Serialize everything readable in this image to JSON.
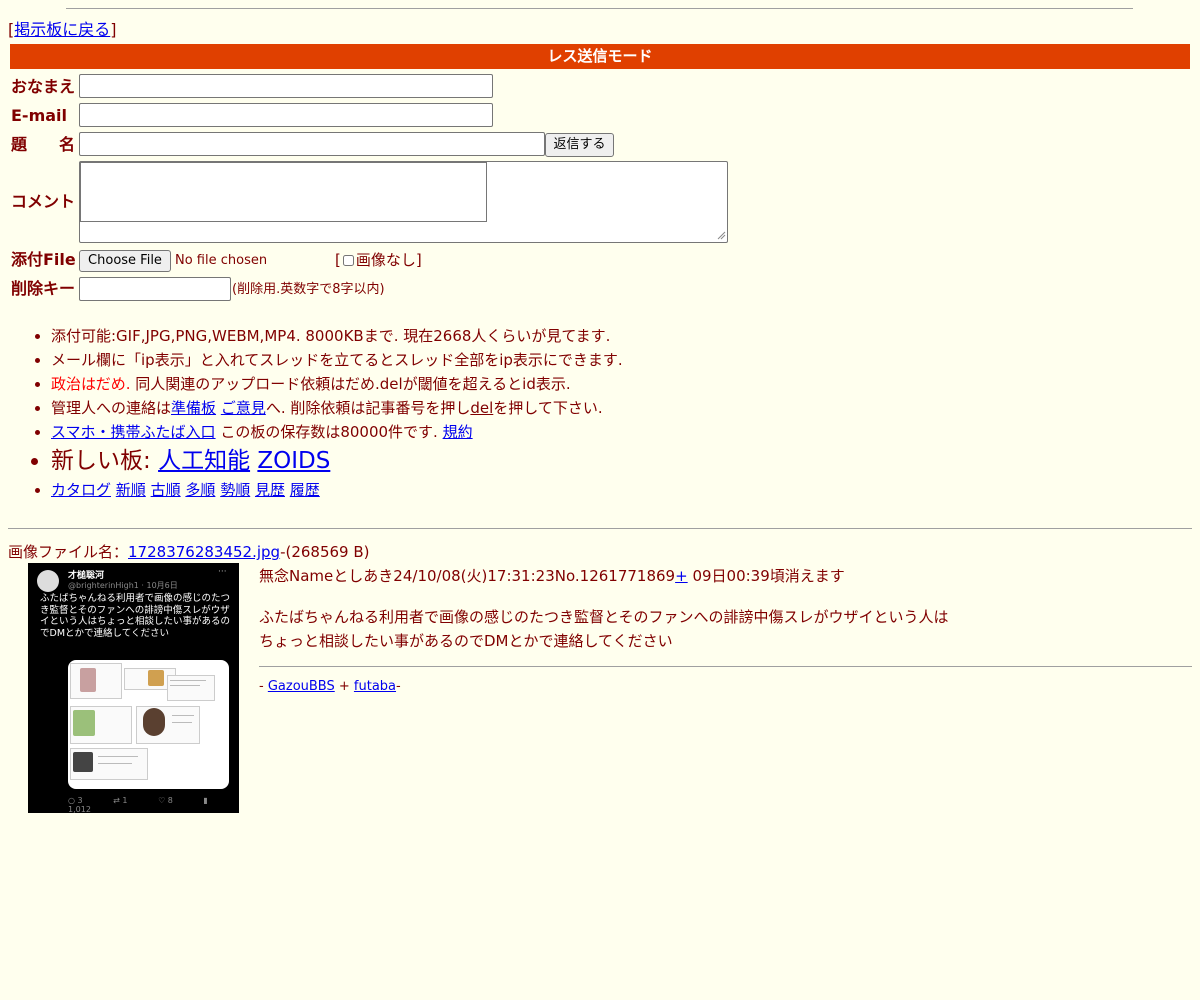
{
  "nav": {
    "back_open": "[",
    "back_label": "掲示板に戻る",
    "back_close": "]"
  },
  "form": {
    "mode_title": "レス送信モード",
    "name_label": "おなまえ",
    "email_label": "E-mail",
    "subject_label": "題　　名",
    "submit_label": "返信する",
    "comment_label": "コメント",
    "file_label": "添付File",
    "choose_file_label": "Choose File",
    "file_status": "No file chosen",
    "noimg_open": "[",
    "noimg_label": "画像なし",
    "noimg_close": "]",
    "delkey_label": "削除キー",
    "delkey_note": "(削除用.英数字で8字以内)",
    "name_value": "",
    "email_value": "",
    "subject_value": "",
    "delkey_value": ""
  },
  "notes": {
    "line1": "添付可能:GIF,JPG,PNG,WEBM,MP4. 8000KBまで. 現在2668人くらいが見てます.",
    "line2": "メール欄に「ip表示」と入れてスレッドを立てるとスレッド全部をip表示にできます.",
    "line3_red": "政治はだめ.",
    "line3_rest": " 同人関連のアップロード依頼はだめ.delが閾値を超えるとid表示.",
    "line4_pre": "管理人への連絡は",
    "line4_link1": "準備板",
    "line4_link2": "ご意見",
    "line4_mid": "へ. 削除依頼は記事番号を押し",
    "line4_del": "del",
    "line4_post": "を押して下さい.",
    "line5_link": "スマホ・携帯ふたば入口",
    "line5_mid": " この板の保存数は80000件です. ",
    "line5_rule": "規約",
    "new_boards_label": "新しい板: ",
    "new_board1": "人工知能",
    "new_board2": "ZOIDS",
    "sort_links": [
      "カタログ",
      "新順",
      "古順",
      "多順",
      "勢順",
      "見歴",
      "履歴"
    ]
  },
  "post": {
    "file_prefix": "画像ファイル名：",
    "file_name": "1728376283452.jpg",
    "file_size": "-(268569 B)",
    "subject": "無念",
    "name": "Name",
    "author": "としあき",
    "datetime": "24/10/08(火)17:31:23",
    "number": "No.1261771869",
    "plus": "+",
    "expire": " 09日00:39頃消えます",
    "body1": "ふたばちゃんねる利用者で画像の感じのたつき監督とそのファンへの誹謗中傷スレがウザイという人は",
    "body2": "ちょっと相談したい事があるのでDMとかで連絡してください"
  },
  "thumbnail": {
    "display_name": "才槌聡河",
    "handle": "@brighterinHigh1 · 10月6日",
    "more": "···",
    "text": "ふたばちゃんねる利用者で画像の感じのたつき監督とそのファンへの誹謗中傷スレがウザイという人はちょっと相談したい事があるのでDMとかで連絡してください",
    "replies": "3",
    "retweets": "1",
    "likes": "8",
    "views": "1,012"
  },
  "footer": {
    "dash1": "- ",
    "link1": "GazouBBS",
    "plus": " + ",
    "link2": "futaba",
    "dash2": "-"
  },
  "colors": {
    "background": "#ffffee",
    "text": "#800000",
    "mode_bar": "#e04000",
    "link": "#0000ee",
    "warning": "#ff0000"
  }
}
